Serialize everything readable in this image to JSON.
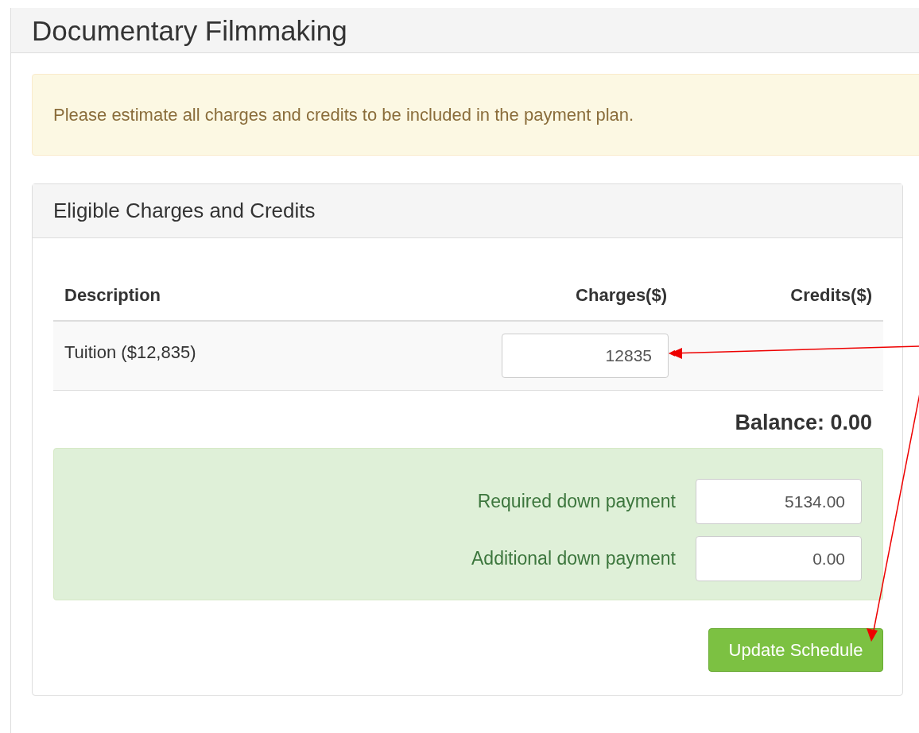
{
  "page": {
    "title": "Documentary Filmmaking"
  },
  "alert": {
    "text": "Please estimate all charges and credits to be included in the payment plan."
  },
  "panel": {
    "title": "Eligible Charges and Credits",
    "table": {
      "columns": [
        "Description",
        "Charges($)",
        "Credits($)"
      ],
      "rows": [
        {
          "description": "Tuition ($12,835)",
          "charges": "12835"
        }
      ]
    },
    "balance": "Balance: 0.00",
    "down_payments": [
      {
        "label": "Required down payment",
        "value": "5134.00"
      },
      {
        "label": "Additional down payment",
        "value": "0.00"
      }
    ],
    "button": "Update Schedule"
  }
}
